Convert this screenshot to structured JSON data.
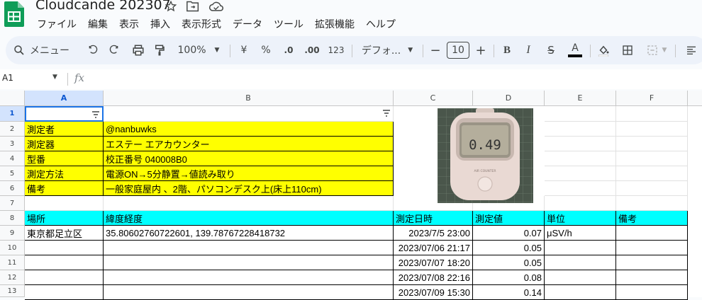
{
  "app": {
    "title": "Cloudcande 202307"
  },
  "menu": [
    "ファイル",
    "編集",
    "表示",
    "挿入",
    "表示形式",
    "データ",
    "ツール",
    "拡張機能",
    "ヘルプ"
  ],
  "toolbar": {
    "search_label": "メニュー",
    "zoom": "100%",
    "currency": "¥",
    "percent": "%",
    "dec_decrease": ".0",
    "dec_increase": ".00",
    "number_format": "123",
    "font": "デフォ...",
    "font_size": "10"
  },
  "formula_bar": {
    "cell_ref": "A1",
    "fx": "fx"
  },
  "columns": [
    "A",
    "B",
    "C",
    "D",
    "E",
    "F"
  ],
  "rows": [
    "1",
    "2",
    "3",
    "4",
    "5",
    "6",
    "7",
    "8",
    "9",
    "10",
    "11",
    "12",
    "13"
  ],
  "info": [
    {
      "label": "測定者",
      "value": "@nanbuwks"
    },
    {
      "label": "測定器",
      "value": "エステー エアカウンター"
    },
    {
      "label": "型番",
      "value": "校正番号 040008B0"
    },
    {
      "label": "測定方法",
      "value": "電源ON→5分静置→値読み取り"
    },
    {
      "label": "備考",
      "value": "一般家庭屋内 、2階、パソコンデスク上(床上110cm)"
    }
  ],
  "photo": {
    "device_text": "AIR COUNTER",
    "reading": "0.49"
  },
  "headers": [
    "場所",
    "緯度経度",
    "測定日時",
    "測定値",
    "単位",
    "備考"
  ],
  "data_rows": [
    {
      "place": "東京都足立区",
      "latlng": "35.80602760722601, 139.78767228418732",
      "datetime": "2023/7/5 23:00",
      "value": "0.07",
      "unit": "μSV/h"
    },
    {
      "place": "",
      "latlng": "",
      "datetime": "2023/07/06 21:17",
      "value": "0.05",
      "unit": ""
    },
    {
      "place": "",
      "latlng": "",
      "datetime": "2023/07/07 18:20",
      "value": "0.05",
      "unit": ""
    },
    {
      "place": "",
      "latlng": "",
      "datetime": "2023/07/08 22:16",
      "value": "0.08",
      "unit": ""
    },
    {
      "place": "",
      "latlng": "",
      "datetime": "2023/07/09 15:30",
      "value": "0.14",
      "unit": ""
    }
  ],
  "colors": {
    "yellow": "#ffff00",
    "cyan": "#00ffff",
    "selection": "#1a73e8",
    "sheets_green": "#0f9d58"
  }
}
